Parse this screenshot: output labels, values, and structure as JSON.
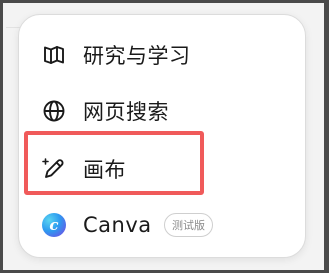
{
  "menu": {
    "items": [
      {
        "label": "研究与学习",
        "icon": "book-icon"
      },
      {
        "label": "网页搜索",
        "icon": "globe-icon"
      },
      {
        "label": "画布",
        "icon": "pen-sparkle-icon"
      },
      {
        "label": "Canva",
        "icon": "canva-logo-icon",
        "badge": "测试版",
        "logo_letter": "c"
      }
    ],
    "highlighted_index": 2,
    "colors": {
      "highlight": "#f05a5a",
      "text": "#1a1a1a",
      "badge_text": "#8a8a8a"
    }
  }
}
